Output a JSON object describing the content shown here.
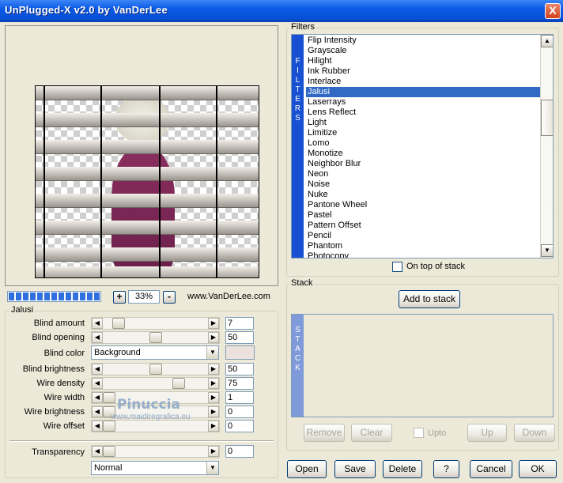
{
  "window": {
    "title": "UnPlugged-X v2.0 by VanDerLee",
    "close_glyph": "X"
  },
  "toolbar": {
    "zoom_out": "-",
    "zoom_in": "+",
    "zoom": "33%",
    "website": "www.VanDerLee.com",
    "render_progress": 1.0
  },
  "params_group": {
    "title": "Jalusi",
    "rows": [
      {
        "label": "Blind amount",
        "value": "7",
        "level": 0.1
      },
      {
        "label": "Blind opening",
        "value": "50",
        "level": 0.5
      },
      {
        "label": "Blind brightness",
        "value": "50",
        "level": 0.5
      },
      {
        "label": "Wire density",
        "value": "75",
        "level": 0.75
      },
      {
        "label": "Wire width",
        "value": "1",
        "level": 0.0
      },
      {
        "label": "Wire brightness",
        "value": "0",
        "level": 0.0
      },
      {
        "label": "Wire offset",
        "value": "0",
        "level": 0.0
      }
    ],
    "blind_color": {
      "label": "Blind color",
      "value": "Background",
      "swatch": "#ece2dd"
    },
    "transparency": {
      "label": "Transparency",
      "value": "0",
      "level": 0.0
    },
    "blend_mode": "Normal"
  },
  "filters": {
    "title": "Filters",
    "band_text": "FILTERS",
    "items": [
      "Flip Intensity",
      "Grayscale",
      "Hilight",
      "Ink Rubber",
      "Interlace",
      "Jalusi",
      "Laserrays",
      "Lens Reflect",
      "Light",
      "Limitize",
      "Lomo",
      "Monotize",
      "Neighbor Blur",
      "Neon",
      "Noise",
      "Nuke",
      "Pantone Wheel",
      "Pastel",
      "Pattern Offset",
      "Pencil",
      "Phantom",
      "Photocopy"
    ],
    "selected": "Jalusi",
    "on_top_label": "On top of stack"
  },
  "stack": {
    "title": "Stack",
    "band_text": "STACK",
    "add_label": "Add to stack",
    "remove_label": "Remove",
    "clear_label": "Clear",
    "upto_label": "Upto",
    "up_label": "Up",
    "down_label": "Down"
  },
  "footer": {
    "open": "Open",
    "save": "Save",
    "delete": "Delete",
    "help": "?",
    "cancel": "Cancel",
    "ok": "OK"
  },
  "watermark": {
    "name": "Pinuccia",
    "url": "www.maidiregrafica.eu"
  },
  "colors": {
    "titlebar": "#0a5ae6",
    "selection": "#316ac5",
    "filters_band": "#1750d0",
    "stack_band": "#7f9ad8"
  }
}
